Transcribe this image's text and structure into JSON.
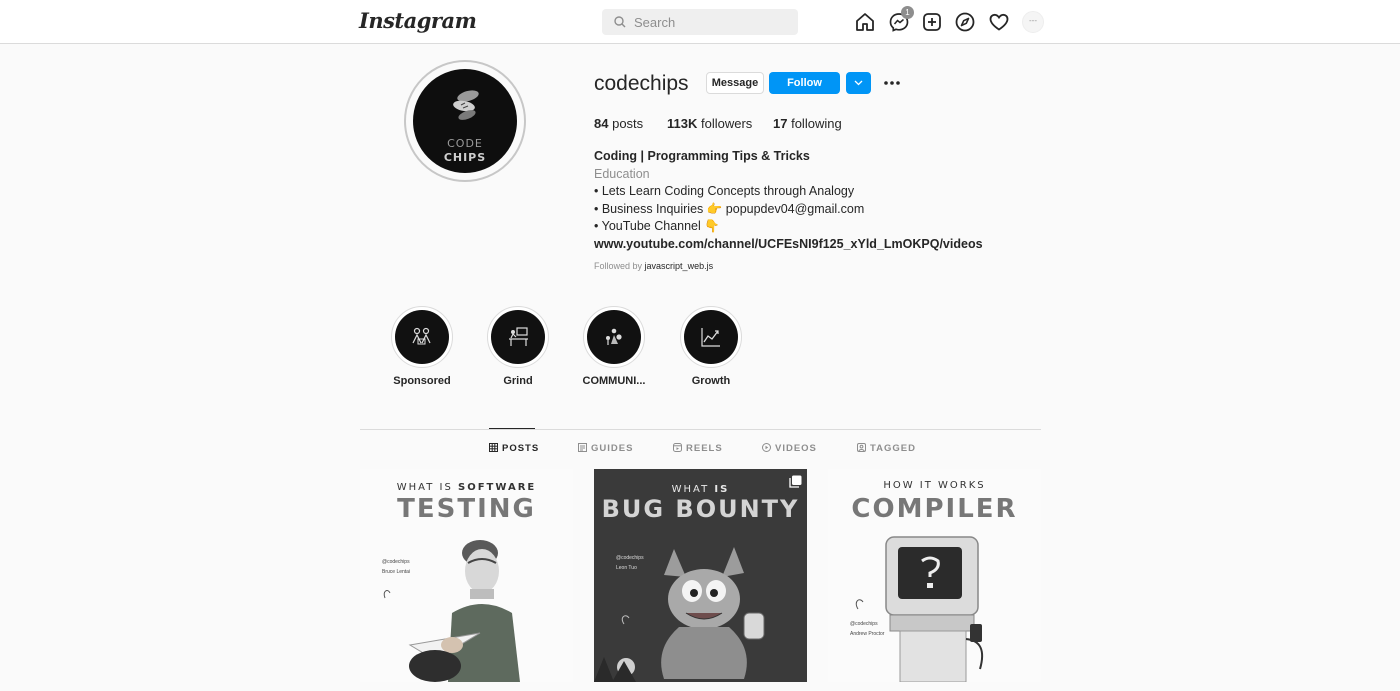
{
  "header": {
    "logo": "Instagram",
    "search_placeholder": "Search",
    "messages_badge": "1",
    "avatar_placeholder": "---"
  },
  "profile": {
    "username": "codechips",
    "avatar_line1": "CODE",
    "avatar_line2": "CHIPS",
    "message_label": "Message",
    "follow_label": "Follow",
    "posts_count": "84",
    "posts_label": "posts",
    "followers_count": "113K",
    "followers_label": "followers",
    "following_count": "17",
    "following_label": "following"
  },
  "bio": {
    "name": "Coding | Programming Tips & Tricks",
    "category": "Education",
    "line1": "• Lets Learn Coding Concepts through Analogy",
    "line2": "• Business Inquiries 👉 popupdev04@gmail.com",
    "line3": "• YouTube Channel 👇",
    "link": "www.youtube.com/channel/UCFEsNI9f125_xYld_LmOKPQ/videos",
    "followed_by_prefix": "Followed by",
    "followed_by_user": "javascript_web.js"
  },
  "highlights": [
    {
      "label": "Sponsored",
      "icon": "sponsored-icon"
    },
    {
      "label": "Grind",
      "icon": "desk-icon"
    },
    {
      "label": "COMMUNI...",
      "icon": "community-icon"
    },
    {
      "label": "Growth",
      "icon": "growth-chart-icon"
    }
  ],
  "tabs": [
    {
      "label": "POSTS",
      "active": true,
      "icon": "grid-icon"
    },
    {
      "label": "GUIDES",
      "active": false,
      "icon": "guides-icon"
    },
    {
      "label": "REELS",
      "active": false,
      "icon": "reels-icon"
    },
    {
      "label": "VIDEOS",
      "active": false,
      "icon": "play-icon"
    },
    {
      "label": "TAGGED",
      "active": false,
      "icon": "tag-icon"
    }
  ],
  "posts": [
    {
      "kicker_pre": "WHAT IS",
      "kicker_bold": "SOFTWARE",
      "title": "TESTING",
      "credit1": "@codechips",
      "credit2": "Bruce Lentai",
      "multi": false
    },
    {
      "kicker_pre": "WHAT",
      "kicker_bold": "IS",
      "title": "BUG BOUNTY",
      "credit1": "@codechips",
      "credit2": "Leon Tuo",
      "multi": true
    },
    {
      "kicker_pre": "HOW IT WORKS",
      "kicker_bold": "",
      "title": "COMPILER",
      "credit1": "@codechips",
      "credit2": "Andrew Proctor",
      "multi": false
    }
  ],
  "colors": {
    "accent": "#0095f6",
    "text": "#262626",
    "secondary_text": "#8e8e8e",
    "border": "#dbdbdb",
    "background": "#fafafa"
  }
}
